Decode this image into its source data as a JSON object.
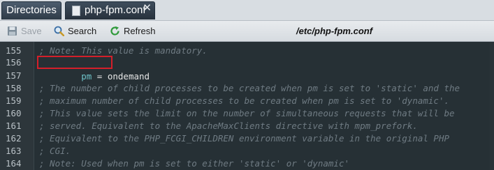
{
  "tabs": [
    {
      "label": "Directories",
      "active": false
    },
    {
      "label": "php-fpm.conf",
      "active": true,
      "close_glyph": "✕"
    }
  ],
  "toolbar": {
    "save_label": "Save",
    "save_icon": "save-icon",
    "search_label": "Search",
    "search_icon": "search-icon",
    "refresh_label": "Refresh",
    "refresh_icon": "refresh-icon",
    "file_path": "/etc/php-fpm.conf"
  },
  "editor": {
    "lines": [
      {
        "num": "155",
        "text": "; Note: This value is mandatory."
      },
      {
        "num": "156",
        "key": "pm",
        "op": " = ",
        "value": "ondemand",
        "highlighted": true
      },
      {
        "num": "157",
        "text": ""
      },
      {
        "num": "158",
        "text": "; The number of child processes to be created when pm is set to 'static' and the"
      },
      {
        "num": "159",
        "text": "; maximum number of child processes to be created when pm is set to 'dynamic'."
      },
      {
        "num": "160",
        "text": "; This value sets the limit on the number of simultaneous requests that will be"
      },
      {
        "num": "161",
        "text": "; served. Equivalent to the ApacheMaxClients directive with mpm_prefork."
      },
      {
        "num": "162",
        "text": "; Equivalent to the PHP_FCGI_CHILDREN environment variable in the original PHP"
      },
      {
        "num": "163",
        "text": "; CGI."
      },
      {
        "num": "164",
        "text": "; Note: Used when pm is set to either 'static' or 'dynamic'"
      }
    ]
  },
  "colors": {
    "editor_bg": "#263035",
    "comment": "#6f7b83",
    "keyword": "#6ec3c9",
    "highlight_border": "#d41f2a",
    "refresh_green": "#2f9a3a"
  }
}
